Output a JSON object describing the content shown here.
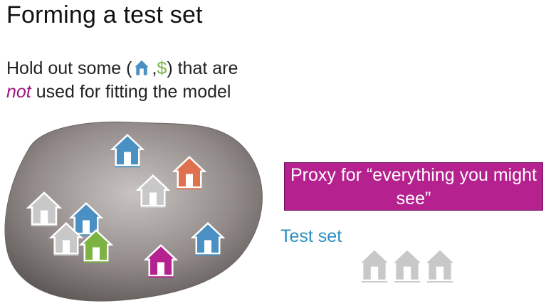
{
  "slide": {
    "title": "Forming a test set",
    "line1_prefix": "Hold out some (",
    "line1_comma": ",",
    "line1_dollar": "$",
    "line1_suffix": ") that are",
    "line2_emph": "not",
    "line2_rest": " used for fitting the model",
    "proxy_text": "Proxy for “everything you might see”",
    "test_set_label": "Test set"
  },
  "colors": {
    "blue_house": "#4a90c2",
    "orange_house": "#e0714f",
    "gray_house": "#c8c8c8",
    "green_house": "#7cb342",
    "magenta_house": "#b5218e",
    "proxy_bg": "#b5218e",
    "test_label": "#2a8fbd",
    "not_emphasis": "#a3167e",
    "dollar": "#7cb342"
  },
  "icons": [
    "house-icon"
  ]
}
